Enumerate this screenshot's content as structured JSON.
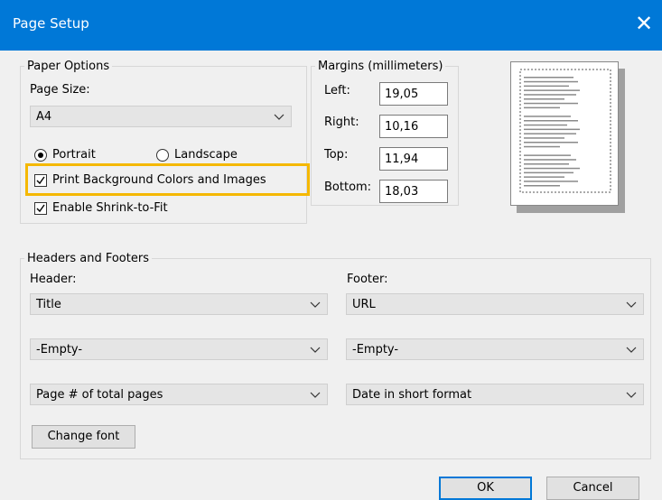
{
  "window": {
    "title": "Page Setup",
    "close_glyph": "✕"
  },
  "paper_options": {
    "legend": "Paper Options",
    "page_size_label": "Page Size:",
    "page_size_value": "A4",
    "portrait_label": "Portrait",
    "landscape_label": "Landscape",
    "orientation_selected": "Portrait",
    "print_background_label": "Print Background Colors and Images",
    "print_background_checked": true,
    "shrink_label": "Enable Shrink-to-Fit",
    "shrink_checked": true
  },
  "margins": {
    "legend": "Margins (millimeters)",
    "left_label": "Left:",
    "left_value": "19,05",
    "right_label": "Right:",
    "right_value": "10,16",
    "top_label": "Top:",
    "top_value": "11,94",
    "bottom_label": "Bottom:",
    "bottom_value": "18,03"
  },
  "headers_footers": {
    "legend": "Headers and Footers",
    "header_label": "Header:",
    "footer_label": "Footer:",
    "header1": "Title",
    "header2": "-Empty-",
    "header3": "Page # of total pages",
    "footer1": "URL",
    "footer2": "-Empty-",
    "footer3": "Date in short format",
    "change_font_label": "Change font"
  },
  "buttons": {
    "ok_label": "OK",
    "cancel_label": "Cancel"
  },
  "colors": {
    "titlebar": "#0078d7",
    "highlight": "#f5b800"
  },
  "icons": [
    "close-icon",
    "chevron-down-icon",
    "checkbox-checked-icon",
    "radio-selected-icon",
    "page-preview-icon"
  ]
}
